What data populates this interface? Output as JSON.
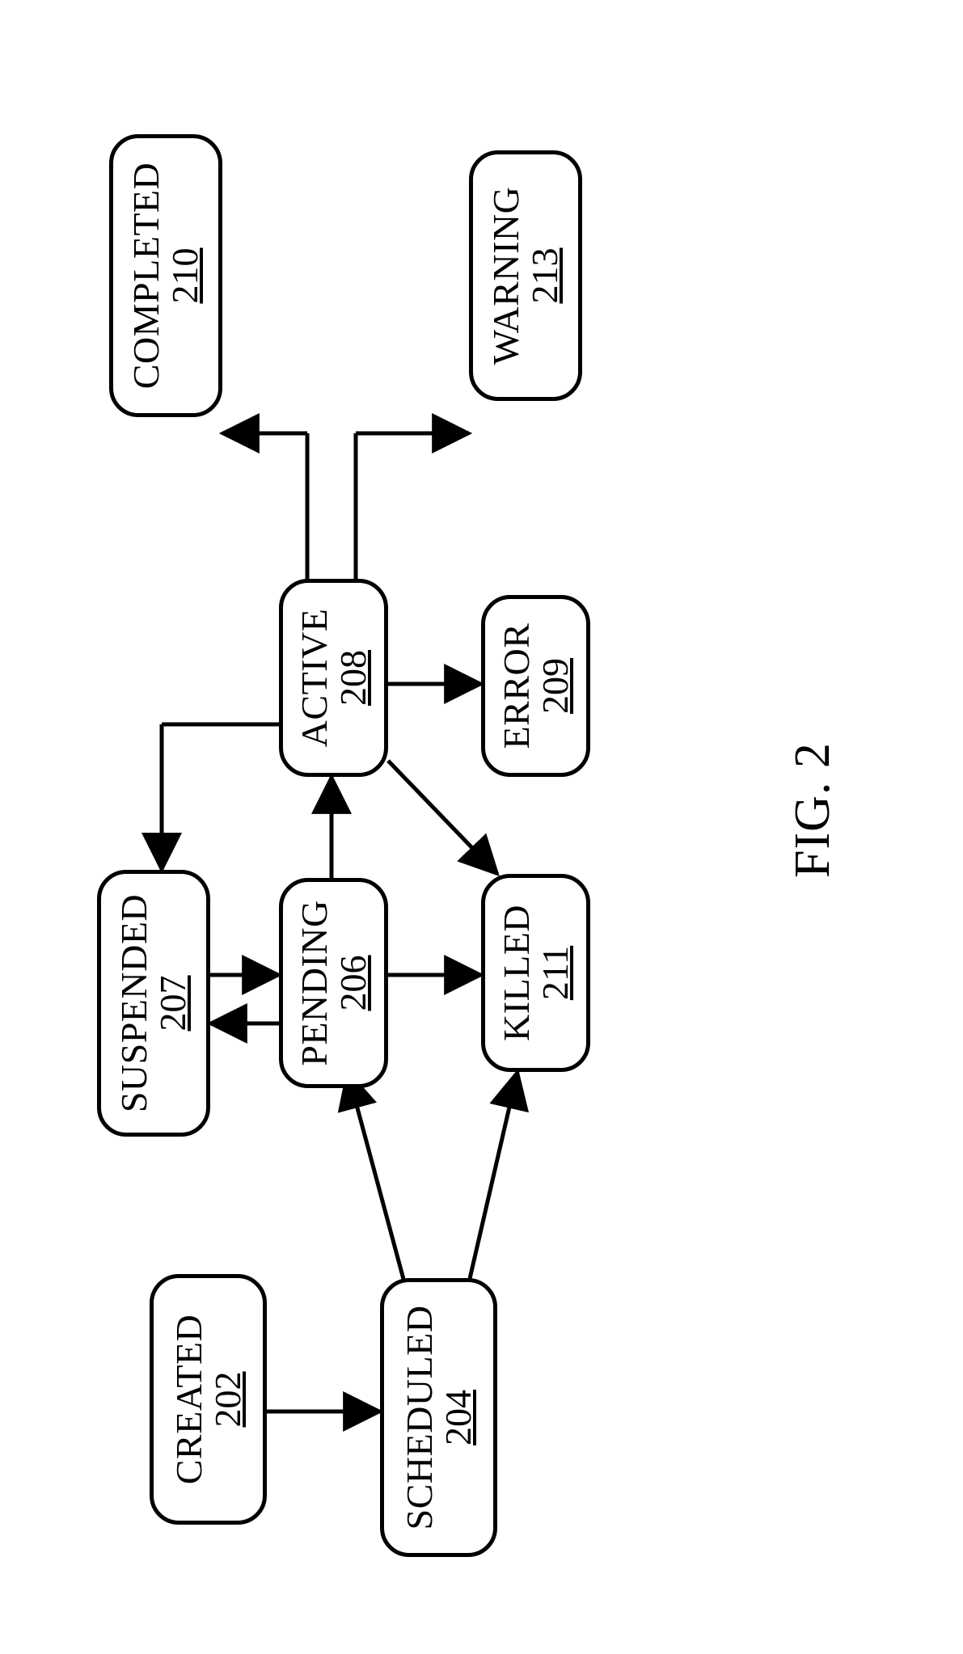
{
  "figure_caption": "FIG. 2",
  "nodes": {
    "created": {
      "label": "CREATED",
      "ref": "202"
    },
    "scheduled": {
      "label": "SCHEDULED",
      "ref": "204"
    },
    "pending": {
      "label": "PENDING",
      "ref": "206"
    },
    "suspended": {
      "label": "SUSPENDED",
      "ref": "207"
    },
    "active": {
      "label": "ACTIVE",
      "ref": "208"
    },
    "error": {
      "label": "ERROR",
      "ref": "209"
    },
    "completed": {
      "label": "COMPLETED",
      "ref": "210"
    },
    "killed": {
      "label": "KILLED",
      "ref": "211"
    },
    "warning": {
      "label": "WARNING",
      "ref": "213"
    }
  },
  "edges": [
    [
      "created",
      "scheduled"
    ],
    [
      "scheduled",
      "pending"
    ],
    [
      "scheduled",
      "killed"
    ],
    [
      "pending",
      "suspended"
    ],
    [
      "suspended",
      "pending"
    ],
    [
      "pending",
      "active"
    ],
    [
      "pending",
      "killed"
    ],
    [
      "active",
      "suspended"
    ],
    [
      "active",
      "killed"
    ],
    [
      "active",
      "error"
    ],
    [
      "active",
      "completed"
    ],
    [
      "active",
      "warning"
    ]
  ]
}
